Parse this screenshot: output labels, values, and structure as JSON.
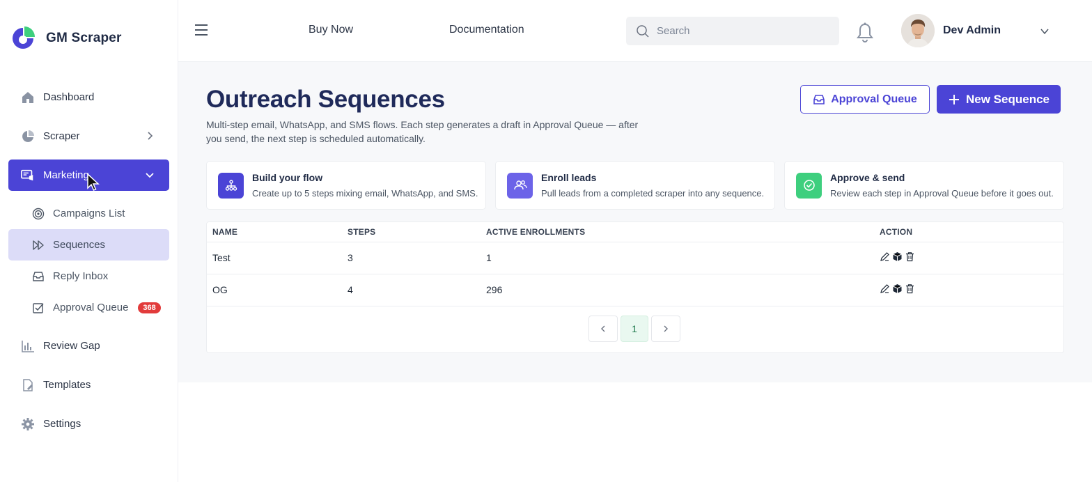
{
  "brand": {
    "name": "GM Scraper"
  },
  "sidebar": {
    "items": [
      {
        "label": "Dashboard",
        "icon": "home-icon"
      },
      {
        "label": "Scraper",
        "icon": "pie-chart-icon"
      },
      {
        "label": "Marketing",
        "icon": "marketing-icon"
      },
      {
        "label": "Review Gap",
        "icon": "bar-chart-icon"
      },
      {
        "label": "Templates",
        "icon": "document-edit-icon"
      },
      {
        "label": "Settings",
        "icon": "gear-icon"
      }
    ],
    "marketing_sub": [
      {
        "label": "Campaigns List",
        "icon": "target-icon"
      },
      {
        "label": "Sequences",
        "icon": "fast-forward-icon"
      },
      {
        "label": "Reply Inbox",
        "icon": "inbox-icon"
      },
      {
        "label": "Approval Queue",
        "icon": "checkbox-icon",
        "badge": "368"
      }
    ]
  },
  "topbar": {
    "links": [
      "Buy Now",
      "Documentation"
    ],
    "search_placeholder": "Search",
    "user_name": "Dev Admin"
  },
  "page": {
    "title": "Outreach Sequences",
    "description": "Multi-step email, WhatsApp, and SMS flows. Each step generates a draft in Approval Queue — after you send, the next step is scheduled automatically.",
    "approval_queue_button": "Approval Queue",
    "new_sequence_button": "New Sequence"
  },
  "cards": [
    {
      "title": "Build your flow",
      "subtitle": "Create up to 5 steps mixing email, WhatsApp, and SMS.",
      "color": "#4b44d6",
      "icon": "flow-icon"
    },
    {
      "title": "Enroll leads",
      "subtitle": "Pull leads from a completed scraper into any sequence.",
      "color": "#6c63e8",
      "icon": "users-icon"
    },
    {
      "title": "Approve & send",
      "subtitle": "Review each step in Approval Queue before it goes out.",
      "color": "#3ecf7e",
      "icon": "check-circle-icon"
    }
  ],
  "table": {
    "headers": [
      "NAME",
      "STEPS",
      "ACTIVE ENROLLMENTS",
      "ACTION"
    ],
    "rows": [
      {
        "name": "Test",
        "steps": "3",
        "active": "1"
      },
      {
        "name": "OG",
        "steps": "4",
        "active": "296"
      }
    ]
  },
  "pagination": {
    "current": "1"
  },
  "colors": {
    "accent": "#4b44d6",
    "badge": "#e23b3b",
    "title": "#1f2a5a"
  }
}
